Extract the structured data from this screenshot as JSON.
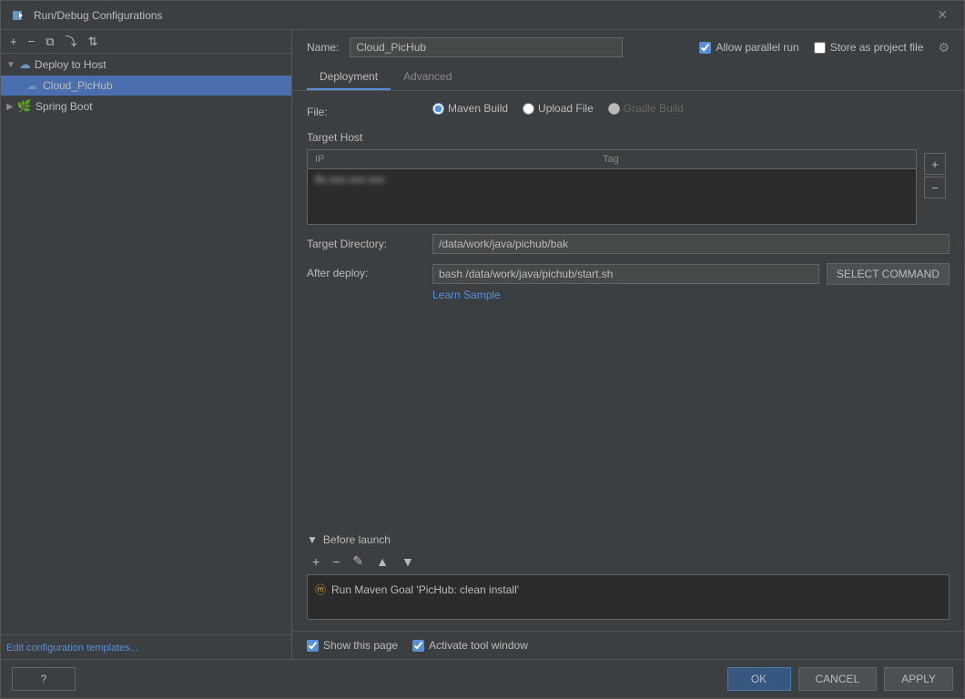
{
  "dialog": {
    "title": "Run/Debug Configurations",
    "close_label": "✕"
  },
  "sidebar": {
    "toolbar": {
      "add_label": "+",
      "remove_label": "−",
      "copy_label": "⧉",
      "move_into_label": "⤵",
      "sort_label": "⇅"
    },
    "groups": [
      {
        "id": "deploy-to-host",
        "label": "Deploy to Host",
        "icon": "☁",
        "expanded": true,
        "items": [
          {
            "id": "cloud-pichub",
            "label": "Cloud_PicHub",
            "icon": "☁",
            "selected": true
          }
        ]
      },
      {
        "id": "spring-boot",
        "label": "Spring Boot",
        "icon": "🌿",
        "expanded": false,
        "items": []
      }
    ],
    "footer_link": "Edit configuration templates..."
  },
  "detail": {
    "name_label": "Name:",
    "name_value": "Cloud_PicHub",
    "allow_parallel_label": "Allow parallel run",
    "store_project_label": "Store as project file",
    "tabs": [
      {
        "id": "deployment",
        "label": "Deployment",
        "active": true
      },
      {
        "id": "advanced",
        "label": "Advanced",
        "active": false
      }
    ],
    "file_label": "File:",
    "file_options": [
      {
        "id": "maven",
        "label": "Maven Build",
        "selected": true
      },
      {
        "id": "upload",
        "label": "Upload File",
        "selected": false
      },
      {
        "id": "gradle",
        "label": "Gradle Build",
        "selected": false,
        "disabled": true
      }
    ],
    "target_host_label": "Target Host",
    "table": {
      "columns": [
        {
          "id": "ip",
          "label": "IP"
        },
        {
          "id": "tag",
          "label": "Tag"
        }
      ],
      "rows": [
        {
          "ip": "8x.xxx.xxx.xxx",
          "tag": ""
        }
      ]
    },
    "target_dir_label": "Target Directory:",
    "target_dir_value": "/data/work/java/pichub/bak",
    "after_deploy_label": "After deploy:",
    "after_deploy_value": "bash /data/work/java/pichub/start.sh",
    "select_command_label": "SELECT COMMAND",
    "learn_sample_label": "Learn Sample",
    "before_launch": {
      "section_label": "Before launch",
      "toolbar": {
        "add": "+",
        "remove": "−",
        "edit": "✎",
        "move_up": "▲",
        "move_down": "▼"
      },
      "items": [
        {
          "id": "maven-goal",
          "label": "Run Maven Goal 'PicHub: clean install'"
        }
      ]
    },
    "show_page_label": "Show this page",
    "activate_window_label": "Activate tool window"
  },
  "footer": {
    "ok_label": "OK",
    "cancel_label": "CANCEL",
    "apply_label": "APPLY"
  },
  "help_label": "?"
}
